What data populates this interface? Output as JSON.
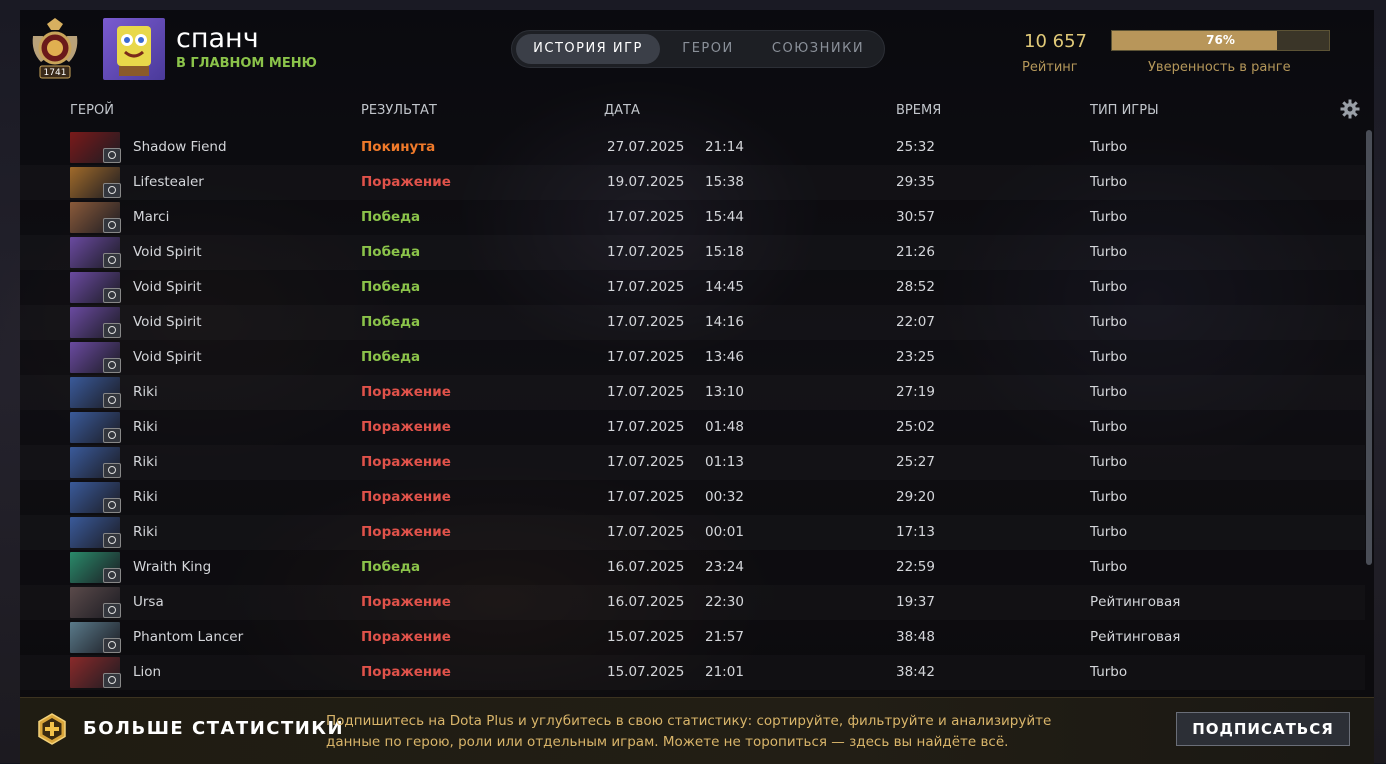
{
  "player": {
    "name": "спанч",
    "status": "В ГЛАВНОМ МЕНЮ",
    "medal_number": "1741"
  },
  "tabs": [
    {
      "label": "ИСТОРИЯ ИГР",
      "active": true
    },
    {
      "label": "ГЕРОИ",
      "active": false
    },
    {
      "label": "СОЮЗНИКИ",
      "active": false
    }
  ],
  "rating": {
    "value": "10 657",
    "label": "Рейтинг"
  },
  "confidence": {
    "percent": 76,
    "text": "76%",
    "label": "Уверенность в ранге"
  },
  "columns": {
    "hero": "ГЕРОЙ",
    "result": "РЕЗУЛЬТАТ",
    "date": "ДАТА",
    "duration": "ВРЕМЯ",
    "type": "ТИП ИГРЫ"
  },
  "colors": {
    "win": "#8bc34a",
    "loss": "#e0524a",
    "abandon": "#f07a2a",
    "accent": "#e0c978"
  },
  "matches": [
    {
      "hero": "Shadow Fiend",
      "result": "Покинута",
      "outcome": "abandon",
      "date": "27.07.2025",
      "time": "21:14",
      "duration": "25:32",
      "type": "Turbo",
      "icon_color": "#7a1a1a"
    },
    {
      "hero": "Lifestealer",
      "result": "Поражение",
      "outcome": "loss",
      "date": "19.07.2025",
      "time": "15:38",
      "duration": "29:35",
      "type": "Turbo",
      "icon_color": "#a06a2a"
    },
    {
      "hero": "Marci",
      "result": "Победа",
      "outcome": "win",
      "date": "17.07.2025",
      "time": "15:44",
      "duration": "30:57",
      "type": "Turbo",
      "icon_color": "#8a5a3a"
    },
    {
      "hero": "Void Spirit",
      "result": "Победа",
      "outcome": "win",
      "date": "17.07.2025",
      "time": "15:18",
      "duration": "21:26",
      "type": "Turbo",
      "icon_color": "#6a4aa0"
    },
    {
      "hero": "Void Spirit",
      "result": "Победа",
      "outcome": "win",
      "date": "17.07.2025",
      "time": "14:45",
      "duration": "28:52",
      "type": "Turbo",
      "icon_color": "#6a4aa0"
    },
    {
      "hero": "Void Spirit",
      "result": "Победа",
      "outcome": "win",
      "date": "17.07.2025",
      "time": "14:16",
      "duration": "22:07",
      "type": "Turbo",
      "icon_color": "#6a4aa0"
    },
    {
      "hero": "Void Spirit",
      "result": "Победа",
      "outcome": "win",
      "date": "17.07.2025",
      "time": "13:46",
      "duration": "23:25",
      "type": "Turbo",
      "icon_color": "#6a4aa0"
    },
    {
      "hero": "Riki",
      "result": "Поражение",
      "outcome": "loss",
      "date": "17.07.2025",
      "time": "13:10",
      "duration": "27:19",
      "type": "Turbo",
      "icon_color": "#3a5a9a"
    },
    {
      "hero": "Riki",
      "result": "Поражение",
      "outcome": "loss",
      "date": "17.07.2025",
      "time": "01:48",
      "duration": "25:02",
      "type": "Turbo",
      "icon_color": "#3a5a9a"
    },
    {
      "hero": "Riki",
      "result": "Поражение",
      "outcome": "loss",
      "date": "17.07.2025",
      "time": "01:13",
      "duration": "25:27",
      "type": "Turbo",
      "icon_color": "#3a5a9a"
    },
    {
      "hero": "Riki",
      "result": "Поражение",
      "outcome": "loss",
      "date": "17.07.2025",
      "time": "00:32",
      "duration": "29:20",
      "type": "Turbo",
      "icon_color": "#3a5a9a"
    },
    {
      "hero": "Riki",
      "result": "Поражение",
      "outcome": "loss",
      "date": "17.07.2025",
      "time": "00:01",
      "duration": "17:13",
      "type": "Turbo",
      "icon_color": "#3a5a9a"
    },
    {
      "hero": "Wraith King",
      "result": "Победа",
      "outcome": "win",
      "date": "16.07.2025",
      "time": "23:24",
      "duration": "22:59",
      "type": "Turbo",
      "icon_color": "#2a8a6a"
    },
    {
      "hero": "Ursa",
      "result": "Поражение",
      "outcome": "loss",
      "date": "16.07.2025",
      "time": "22:30",
      "duration": "19:37",
      "type": "Рейтинговая",
      "icon_color": "#5a4a4a"
    },
    {
      "hero": "Phantom Lancer",
      "result": "Поражение",
      "outcome": "loss",
      "date": "15.07.2025",
      "time": "21:57",
      "duration": "38:48",
      "type": "Рейтинговая",
      "icon_color": "#5a7a8a"
    },
    {
      "hero": "Lion",
      "result": "Поражение",
      "outcome": "loss",
      "date": "15.07.2025",
      "time": "21:01",
      "duration": "38:42",
      "type": "Turbo",
      "icon_color": "#8a2a2a"
    }
  ],
  "footer": {
    "title": "БОЛЬШЕ СТАТИСТИКИ",
    "text": "Подпишитесь на Dota Plus и углубитесь в свою статистику: сортируйте, фильтруйте и анализируйте данные по герою, роли или отдельным играм. Можете не торопиться — здесь вы найдёте всё.",
    "button": "ПОДПИСАТЬСЯ"
  },
  "icons": {
    "medal": "rank-medal-icon",
    "settings": "gear-icon",
    "plus": "dota-plus-icon"
  }
}
